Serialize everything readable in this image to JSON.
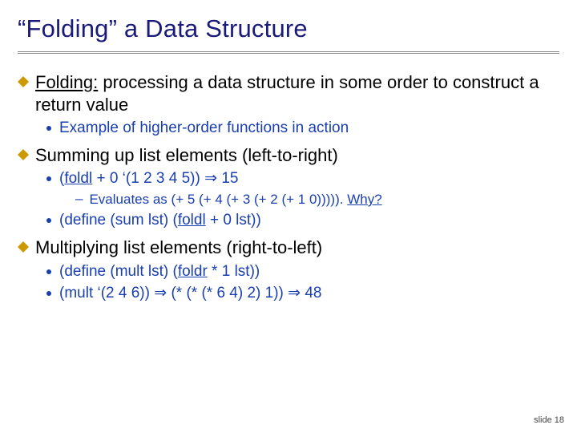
{
  "title": "“Folding” a Data Structure",
  "b1": {
    "term": "Folding:",
    "rest": " processing a data structure in some order to construct a return value"
  },
  "b1s1": "Example of higher-order functions in action",
  "b2": "Summing up list elements (left-to-right)",
  "b2s1": {
    "a": "(",
    "fold": "foldl",
    "b": " + 0 ‘(1 2 3 4 5)) ",
    "arrow": "⇒",
    "c": " 15"
  },
  "b2s1a": {
    "a": "Evaluates as (+ 5 (+ 4 (+ 3 (+ 2 (+ 1 0))))).  ",
    "why": "Why?"
  },
  "b2s2": {
    "a": "(define (sum lst) (",
    "fold": "foldl",
    "b": " + 0 lst))"
  },
  "b3": "Multiplying list elements (right-to-left)",
  "b3s1": {
    "a": "(define (mult lst) (",
    "fold": "foldr",
    "b": " * 1 lst))"
  },
  "b3s2": {
    "a": "(mult ‘(2 4 6)) ",
    "arrow1": "⇒",
    "b": " (* (* (* 6 4) 2) 1)) ",
    "arrow2": "⇒",
    "c": " 48"
  },
  "footer": "slide 18"
}
